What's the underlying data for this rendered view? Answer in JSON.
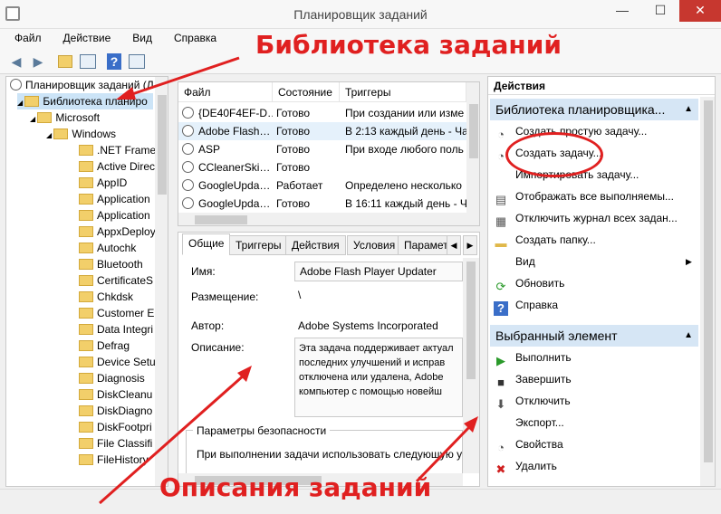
{
  "window": {
    "title": "Планировщик заданий",
    "minimize": "—",
    "maximize": "☐",
    "close": "✕"
  },
  "menu": [
    "Файл",
    "Действие",
    "Вид",
    "Справка"
  ],
  "tree": {
    "root": "Планировщик заданий (Л",
    "library": "Библиотека планиро",
    "microsoft": "Microsoft",
    "windows": "Windows",
    "items": [
      ".NET Frame",
      "Active Direc",
      "AppID",
      "Application",
      "Application",
      "AppxDeploy",
      "Autochk",
      "Bluetooth",
      "CertificateS",
      "Chkdsk",
      "Customer E",
      "Data Integri",
      "Defrag",
      "Device Setu",
      "Diagnosis",
      "DiskCleanu",
      "DiskDiagno",
      "DiskFootpri",
      "File Classifi",
      "FileHistory"
    ]
  },
  "tasks": {
    "headers": [
      "Файл",
      "Состояние",
      "Триггеры"
    ],
    "rows": [
      [
        "{DE40F4EF-D…",
        "Готово",
        "При создании или изме"
      ],
      [
        "Adobe Flash…",
        "Готово",
        "В 2:13 каждый день - Час"
      ],
      [
        "ASP",
        "Готово",
        "При входе любого поль"
      ],
      [
        "CCleanerSki…",
        "Готово",
        ""
      ],
      [
        "GoogleUpda…",
        "Работает",
        "Определено несколько"
      ],
      [
        "GoogleUpda…",
        "Готово",
        "В 16:11 каждый день - Ча"
      ]
    ]
  },
  "detail": {
    "tabs": [
      "Общие",
      "Триггеры",
      "Действия",
      "Условия",
      "Парамет"
    ],
    "name_label": "Имя:",
    "name_value": "Adobe Flash Player Updater",
    "location_label": "Размещение:",
    "location_value": "\\",
    "author_label": "Автор:",
    "author_value": "Adobe Systems Incorporated",
    "desc_label": "Описание:",
    "desc_lines": [
      "Эта задача поддерживает актуал",
      "последних улучшений и исправ",
      "отключена или удалена, Adobe",
      "компьютер с помощью новейш"
    ],
    "security_title": "Параметры безопасности",
    "security_text": "При выполнении задачи использовать следующую у"
  },
  "actions": {
    "header": "Действия",
    "section1": "Библиотека планировщика...",
    "items1": [
      {
        "icon": "create-basic-task-icon",
        "label": "Создать простую задачу..."
      },
      {
        "icon": "create-task-icon",
        "label": "Создать задачу..."
      },
      {
        "icon": "import-task-icon",
        "label": "Импортировать задачу..."
      },
      {
        "icon": "display-running-icon",
        "label": "Отображать все выполняемы..."
      },
      {
        "icon": "disable-history-icon",
        "label": "Отключить журнал всех задан..."
      },
      {
        "icon": "new-folder-icon",
        "label": "Создать папку..."
      },
      {
        "icon": "view-icon",
        "label": "Вид"
      },
      {
        "icon": "refresh-icon",
        "label": "Обновить"
      },
      {
        "icon": "help-icon",
        "label": "Справка"
      }
    ],
    "section2": "Выбранный элемент",
    "items2": [
      {
        "icon": "run-icon",
        "label": "Выполнить"
      },
      {
        "icon": "end-icon",
        "label": "Завершить"
      },
      {
        "icon": "disable-icon",
        "label": "Отключить"
      },
      {
        "icon": "export-icon",
        "label": "Экспорт..."
      },
      {
        "icon": "properties-icon",
        "label": "Свойства"
      },
      {
        "icon": "delete-icon",
        "label": "Удалить"
      }
    ]
  },
  "annotations": {
    "library": "Библиотека заданий",
    "descriptions": "Описания заданий"
  },
  "colors": {
    "annotation": "#e02020",
    "section_bg": "#d6e6f5",
    "close_bg": "#c7372f"
  }
}
